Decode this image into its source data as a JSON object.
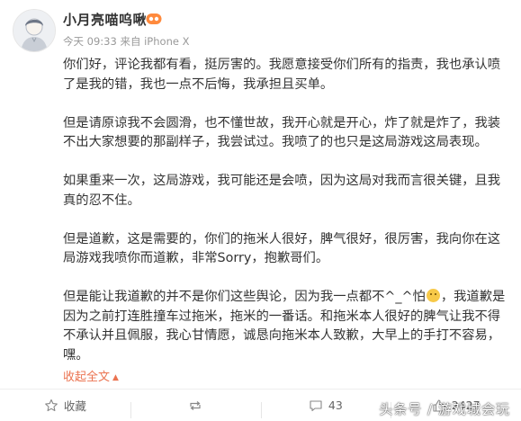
{
  "user": {
    "name": "小月亮喵呜啾"
  },
  "meta": {
    "time": "今天 09:33",
    "source": "来自 iPhone X"
  },
  "post": {
    "p1": "你们好，评论我都有看，挺厉害的。我愿意接受你们所有的指责，我也承认喷了是我的错，我也一点不后悔，我承担且买单。",
    "p2": "但是请原谅我不会圆滑，也不懂世故，我开心就是开心，炸了就是炸了，我装不出大家想要的那副样子，我尝试过。我喷了的也只是这局游戏这局表现。",
    "p3": "如果重来一次，这局游戏，我可能还是会喷，因为这局对我而言很关键，且我真的忍不住。",
    "p4": "但是道歉，这是需要的，你们的拖米人很好，脾气很好，很厉害，我向你在这局游戏我喷你而道歉，非常Sorry，抱歉哥们。",
    "p5a": "但是能让我道歉的并不是你们这些舆论，因为我一点都不^_^怕",
    "p5b": "，我道歉是因为之前打连胜撞车过拖米，拖米的一番话。和拖米本人很好的脾气让我不得不承认并且佩服，我心甘情愿，诚恳向拖米本人致歉，大早上的手打不容易，嘿。"
  },
  "collapse_label": "收起全文",
  "actions": {
    "favorite": "收藏",
    "comment": "43",
    "like": "2427"
  },
  "watermark": "头条号 / 游戏城会玩",
  "colors": {
    "link": "#eb7350",
    "text": "#333333",
    "meta": "#999999"
  }
}
